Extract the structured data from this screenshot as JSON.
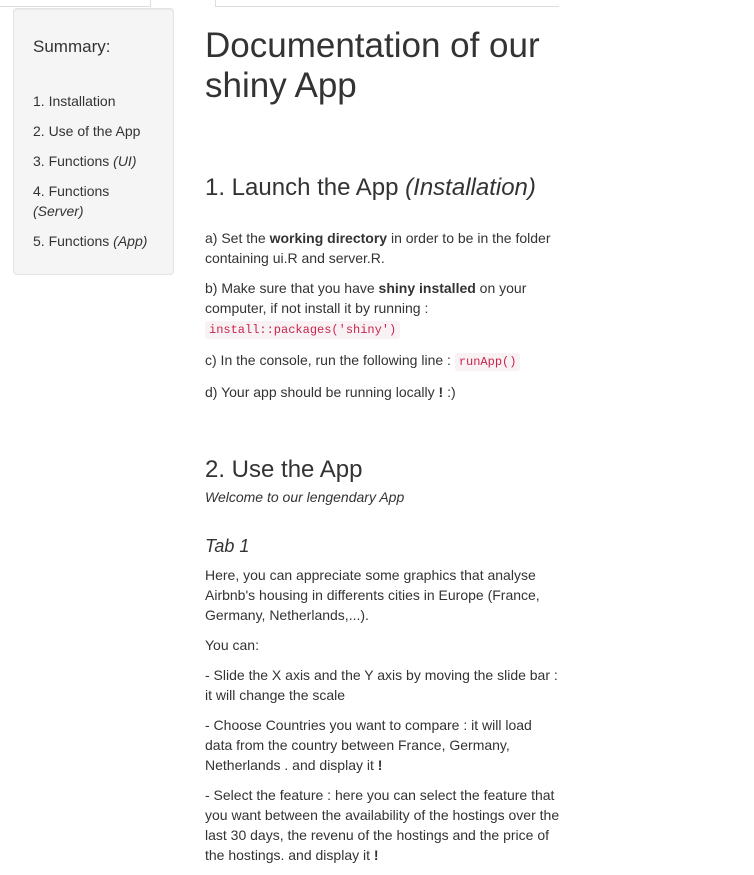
{
  "sidebar": {
    "title": "Summary:",
    "items": [
      {
        "label": "1. Installation",
        "suffix": ""
      },
      {
        "label": "2. Use of the App",
        "suffix": ""
      },
      {
        "label": "3. Functions ",
        "suffix": "(UI)"
      },
      {
        "label": "4. Functions ",
        "suffix": "(Server)"
      },
      {
        "label": "5. Functions ",
        "suffix": "(App)"
      }
    ]
  },
  "main": {
    "title": "Documentation of our shiny App",
    "section1": {
      "heading": "1. Launch the App ",
      "heading_italic": "(Installation)",
      "step_a": {
        "pre": "a) Set the ",
        "bold": "working directory",
        "post": " in order to be in the folder containing ui.R and server.R."
      },
      "step_b": {
        "pre": "b) Make sure that you have ",
        "bold": "shiny installed",
        "post": " on your computer, if not install it by running : ",
        "code": "install::packages('shiny')"
      },
      "step_c": {
        "pre": "c) In the console, run the following line : ",
        "code": "runApp()"
      },
      "step_d": {
        "pre": "d) Your app should be running locally ",
        "bold": "!",
        "post": " :)"
      }
    },
    "section2": {
      "heading": "2. Use the App",
      "welcome": "Welcome to our lengendary App",
      "tab1": {
        "heading": "Tab 1",
        "intro": "Here, you can appreciate some graphics that analyse Airbnb's housing in differents cities in Europe (France, Germany, Netherlands,...).",
        "you_can": "You can:",
        "bullet1": "- Slide the X axis and the Y axis by moving the slide bar : it will change the scale",
        "bullet2": {
          "text": "- Choose Countries you want to compare : it will load data from the country between France, Germany, Netherlands . and display it ",
          "bold": "!"
        },
        "bullet3": {
          "text": "- Select the feature : here you can select the feature that you want between the availability of the hostings over the last 30 days, the revenu of the hostings and the price of the hostings. and display it ",
          "bold": "!"
        }
      }
    }
  }
}
